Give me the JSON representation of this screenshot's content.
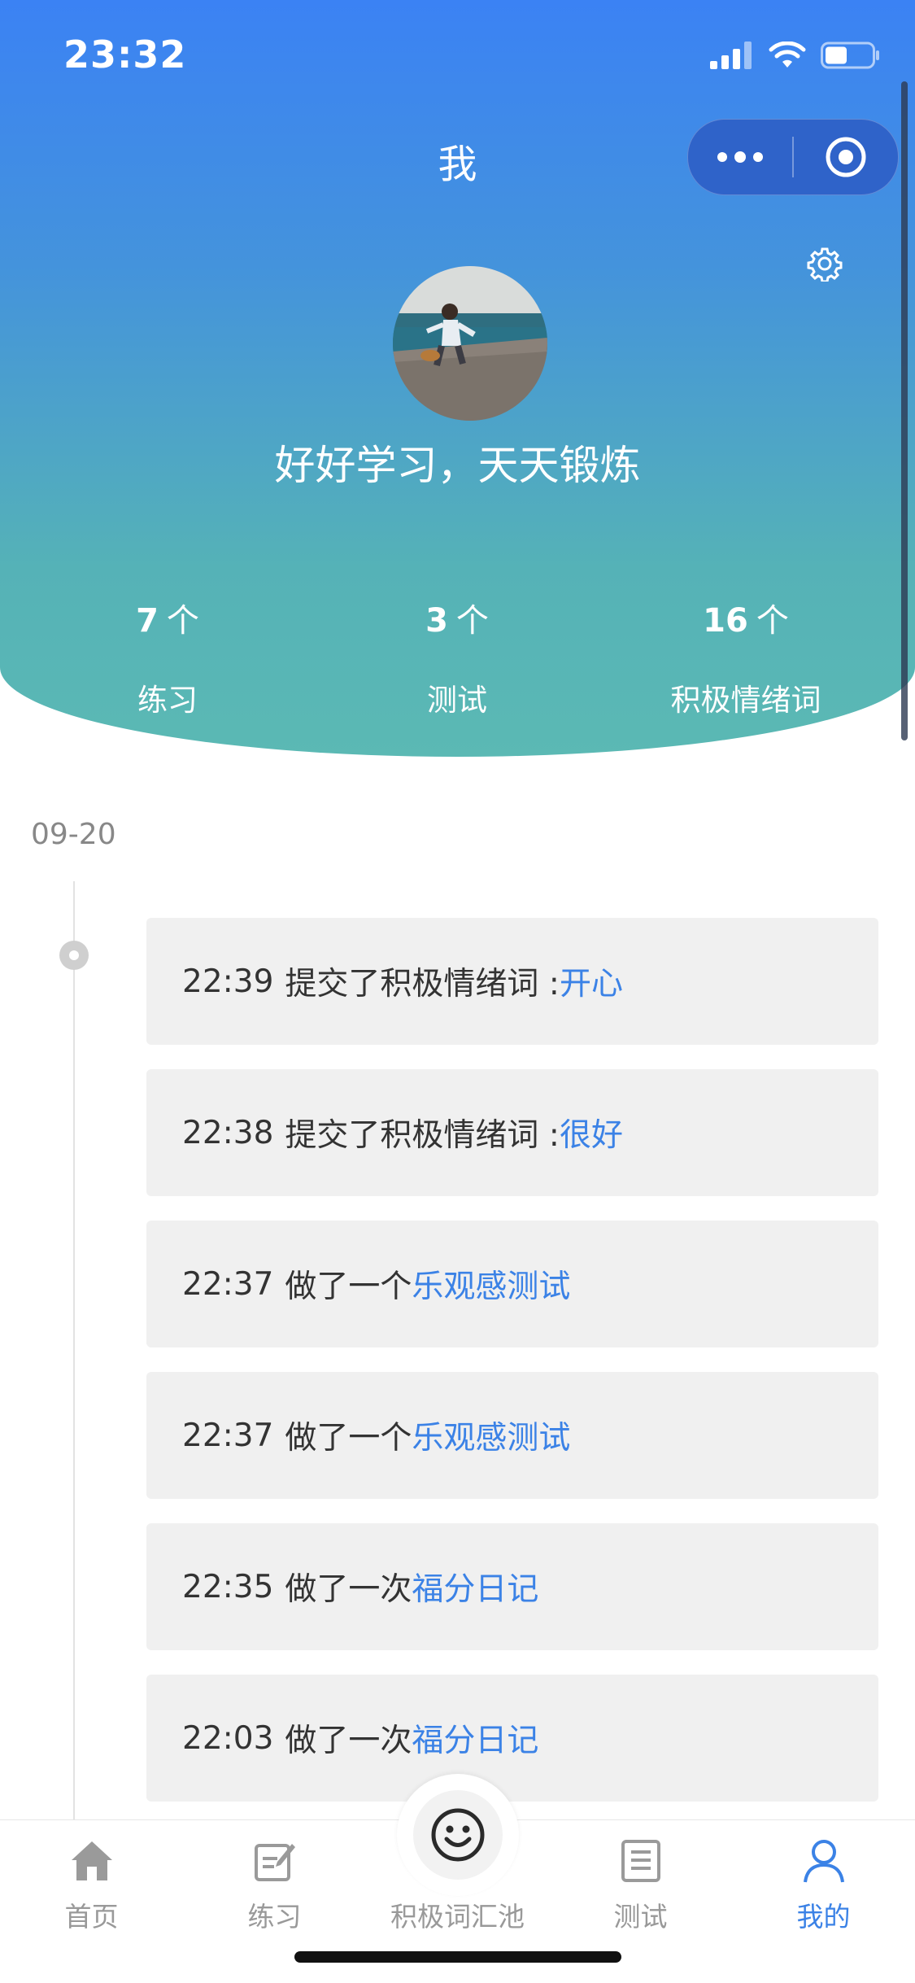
{
  "status": {
    "time": "23:32"
  },
  "nav": {
    "title": "我"
  },
  "profile": {
    "motto": "好好学习，天天锻炼"
  },
  "stats": [
    {
      "value": "7",
      "unit": "个",
      "label": "练习"
    },
    {
      "value": "3",
      "unit": "个",
      "label": "测试"
    },
    {
      "value": "16",
      "unit": "个",
      "label": "积极情绪词"
    }
  ],
  "timeline": {
    "date": "09-20",
    "items": [
      {
        "time": "22:39",
        "action": "提交了积极情绪词 : ",
        "target": "开心"
      },
      {
        "time": "22:38",
        "action": "提交了积极情绪词 : ",
        "target": "很好"
      },
      {
        "time": "22:37",
        "action": "做了一个 ",
        "target": "乐观感测试"
      },
      {
        "time": "22:37",
        "action": "做了一个 ",
        "target": "乐观感测试"
      },
      {
        "time": "22:35",
        "action": "做了一次 ",
        "target": "福分日记"
      },
      {
        "time": "22:03",
        "action": "做了一次 ",
        "target": "福分日记"
      }
    ]
  },
  "tabbar": {
    "items": [
      {
        "label": "首页",
        "icon": "home-icon"
      },
      {
        "label": "练习",
        "icon": "edit-icon"
      },
      {
        "label": "积极词汇池",
        "icon": "smile-icon"
      },
      {
        "label": "测试",
        "icon": "document-icon"
      },
      {
        "label": "我的",
        "icon": "user-icon"
      }
    ],
    "active_index": 4
  },
  "colors": {
    "accent": "#3b82e6",
    "header_top": "#3b82f4",
    "header_bottom": "#5bb9b4"
  }
}
